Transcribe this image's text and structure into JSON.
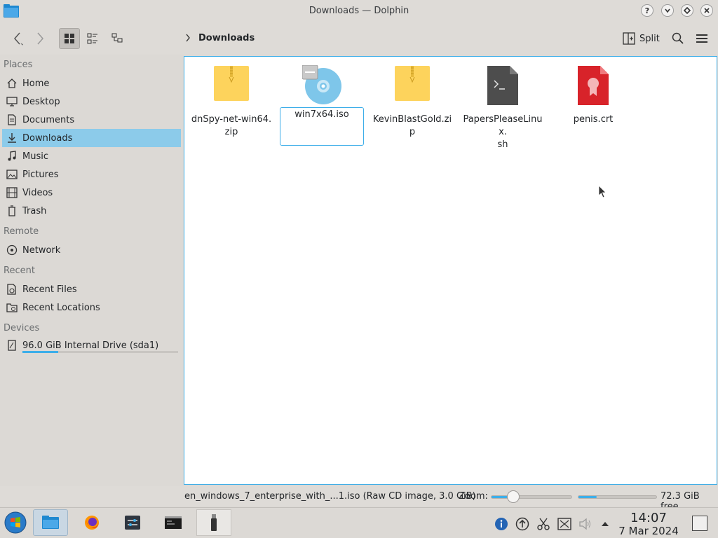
{
  "window": {
    "title": "Downloads — Dolphin"
  },
  "title_buttons": {
    "help": "?",
    "minimize": "˅",
    "maximize": "◇",
    "close": "✕"
  },
  "toolbar": {
    "breadcrumb": "Downloads",
    "split_label": "Split"
  },
  "sidebar": {
    "sections": {
      "places": "Places",
      "remote": "Remote",
      "recent": "Recent",
      "devices": "Devices"
    },
    "places": [
      {
        "label": "Home",
        "icon": "home-icon"
      },
      {
        "label": "Desktop",
        "icon": "desktop-icon"
      },
      {
        "label": "Documents",
        "icon": "documents-icon"
      },
      {
        "label": "Downloads",
        "icon": "downloads-icon",
        "selected": true
      },
      {
        "label": "Music",
        "icon": "music-icon"
      },
      {
        "label": "Pictures",
        "icon": "pictures-icon"
      },
      {
        "label": "Videos",
        "icon": "videos-icon"
      },
      {
        "label": "Trash",
        "icon": "trash-icon"
      }
    ],
    "remote": [
      {
        "label": "Network",
        "icon": "network-icon"
      }
    ],
    "recent": [
      {
        "label": "Recent Files",
        "icon": "recent-files-icon"
      },
      {
        "label": "Recent Locations",
        "icon": "recent-locations-icon"
      }
    ],
    "devices": [
      {
        "label": "96.0 GiB Internal Drive (sda1)",
        "icon": "drive-icon",
        "usage_fraction": 0.23
      }
    ]
  },
  "files": [
    {
      "name": "dnSpy-net-win64.zip",
      "line1": "dnSpy-net-win64.",
      "line2": "zip",
      "icon": "zip-archive-icon"
    },
    {
      "name": "win7x64.iso",
      "line1": "win7x64.iso",
      "line2": "",
      "icon": "disc-image-icon",
      "focused": true
    },
    {
      "name": "KevinBlastGold.zip",
      "line1": "KevinBlastGold.zip",
      "line2": "",
      "icon": "zip-archive-icon"
    },
    {
      "name": "PapersPleaseLinux.sh",
      "line1": "PapersPleaseLinux.",
      "line2": "sh",
      "icon": "shell-script-icon"
    },
    {
      "name": "penis.crt",
      "line1": "penis.crt",
      "line2": "",
      "icon": "certificate-icon"
    }
  ],
  "statusbar": {
    "info": "en_windows_7_enterprise_with_...1.iso (Raw CD image, 3.0 GiB)",
    "zoom_label": "Zoom:",
    "zoom_fraction": 0.25,
    "free_fraction": 0.23,
    "free_label": "72.3 GiB free"
  },
  "taskbar": {
    "time": "14:07",
    "date": "7 Mar 2024"
  },
  "colors": {
    "accent": "#3daee9",
    "selection": "#8ccbea",
    "cert_red": "#d8232a",
    "zip_yellow": "#fdd35c"
  }
}
